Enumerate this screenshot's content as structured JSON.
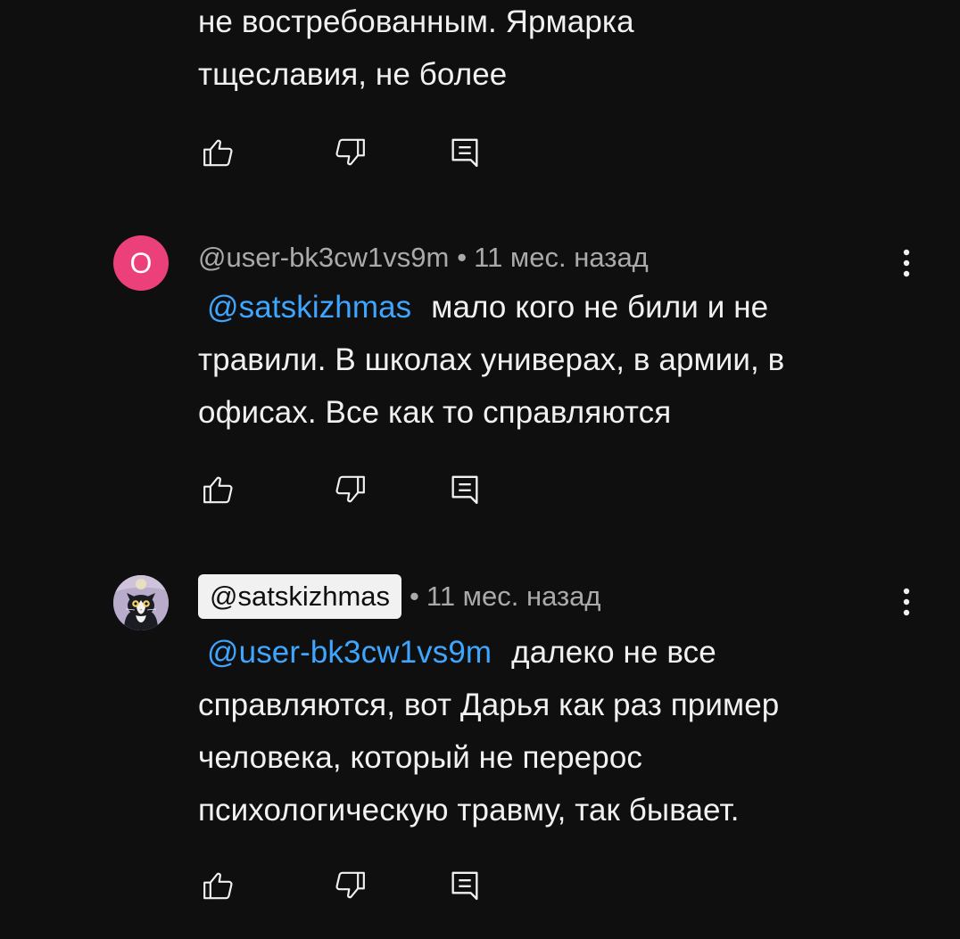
{
  "comments": [
    {
      "text_lines": [
        "не востребованным. Ярмарка",
        "тщеславия, не более"
      ]
    },
    {
      "avatar_letter": "О",
      "avatar_color": "#ec407a",
      "author": "@user-bk3cw1vs9m",
      "separator": "•",
      "time": "11 мес. назад",
      "mention": "@satskizhmas",
      "text_first": "мало кого не били и не",
      "text_lines": [
        "травили. В школах универах, в армии, в",
        "офисах. Все как то справляются"
      ]
    },
    {
      "avatar_icon": "cat-avatar",
      "author": "@satskizhmas",
      "separator": "•",
      "time": "11 мес. назад",
      "mention": "@user-bk3cw1vs9m",
      "text_first": "далеко не все",
      "text_lines": [
        "справляются, вот Дарья как раз пример",
        "человека, который не перерос",
        "психологическую травму, так бывает."
      ]
    }
  ],
  "icons": {
    "like": "thumb-up-icon",
    "dislike": "thumb-down-icon",
    "reply": "reply-comment-icon",
    "menu": "more-vertical-icon"
  },
  "colors": {
    "background": "#0f0f0f",
    "text": "#f1f1f1",
    "meta": "#aaaaaa",
    "mention": "#3ea6ff"
  }
}
